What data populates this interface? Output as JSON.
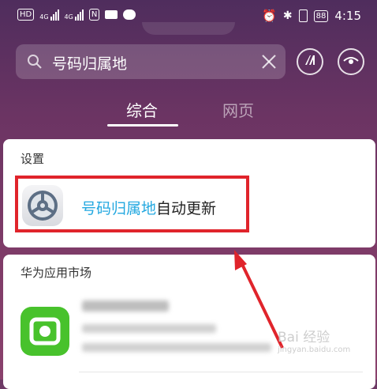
{
  "status_bar": {
    "left": {
      "hd_label": "HD",
      "net_label_1": "4G",
      "net_label_2": "4G",
      "nfc_label": "N"
    },
    "right": {
      "battery_label": "88",
      "time": "4:15"
    }
  },
  "search": {
    "value": "号码归属地"
  },
  "tabs": [
    {
      "label": "综合",
      "active": true
    },
    {
      "label": "网页",
      "active": false
    }
  ],
  "settings_card": {
    "title": "设置",
    "result": {
      "highlight": "号码归属地",
      "rest": "自动更新"
    }
  },
  "market_card": {
    "title": "华为应用市场"
  },
  "watermark": {
    "text": "Bai 经验",
    "sub": "jingyan.baidu.com"
  },
  "colors": {
    "highlight": "#23a8e0",
    "annotation_red": "#e0242b",
    "app_green": "#48c22c"
  },
  "icons": [
    "search-icon",
    "clear-icon",
    "ai-lens-icon",
    "eye-icon",
    "settings-gear-icon",
    "app-icon"
  ]
}
